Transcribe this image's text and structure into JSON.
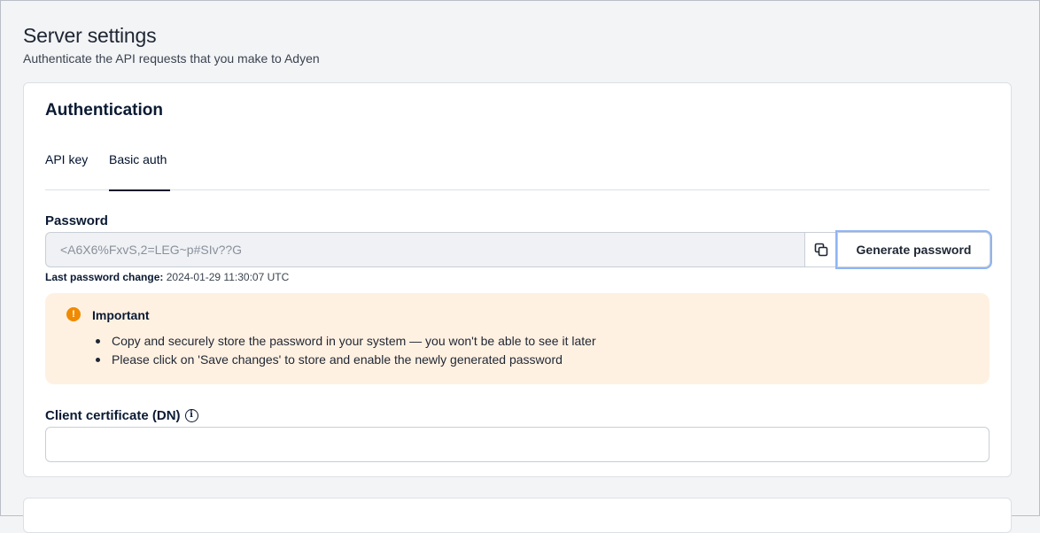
{
  "header": {
    "title": "Server settings",
    "subtitle": "Authenticate the API requests that you make to Adyen"
  },
  "auth": {
    "title": "Authentication",
    "tabs": [
      {
        "label": "API key",
        "active": false
      },
      {
        "label": "Basic auth",
        "active": true
      }
    ],
    "password": {
      "label": "Password",
      "value": "<A6X6%FxvS,2=LEG~p#SIv??G",
      "copy_icon": "copy-icon",
      "generate_label": "Generate password",
      "last_change_key": "Last password change:",
      "last_change_value": "2024-01-29 11:30:07 UTC"
    },
    "alert": {
      "icon": "warning-icon",
      "title": "Important",
      "items": [
        "Copy and securely store the password in your system — you won't be able to see it later",
        "Please click on 'Save changes' to store and enable the newly generated password"
      ]
    },
    "client_certificate": {
      "label": "Client certificate (DN)",
      "value": "",
      "info_icon": "info-icon"
    }
  },
  "colors": {
    "accent": "#00112c",
    "alert_bg": "#fff1e2",
    "alert_icon": "#f08a00",
    "focus_ring": "#8fb4f5"
  }
}
